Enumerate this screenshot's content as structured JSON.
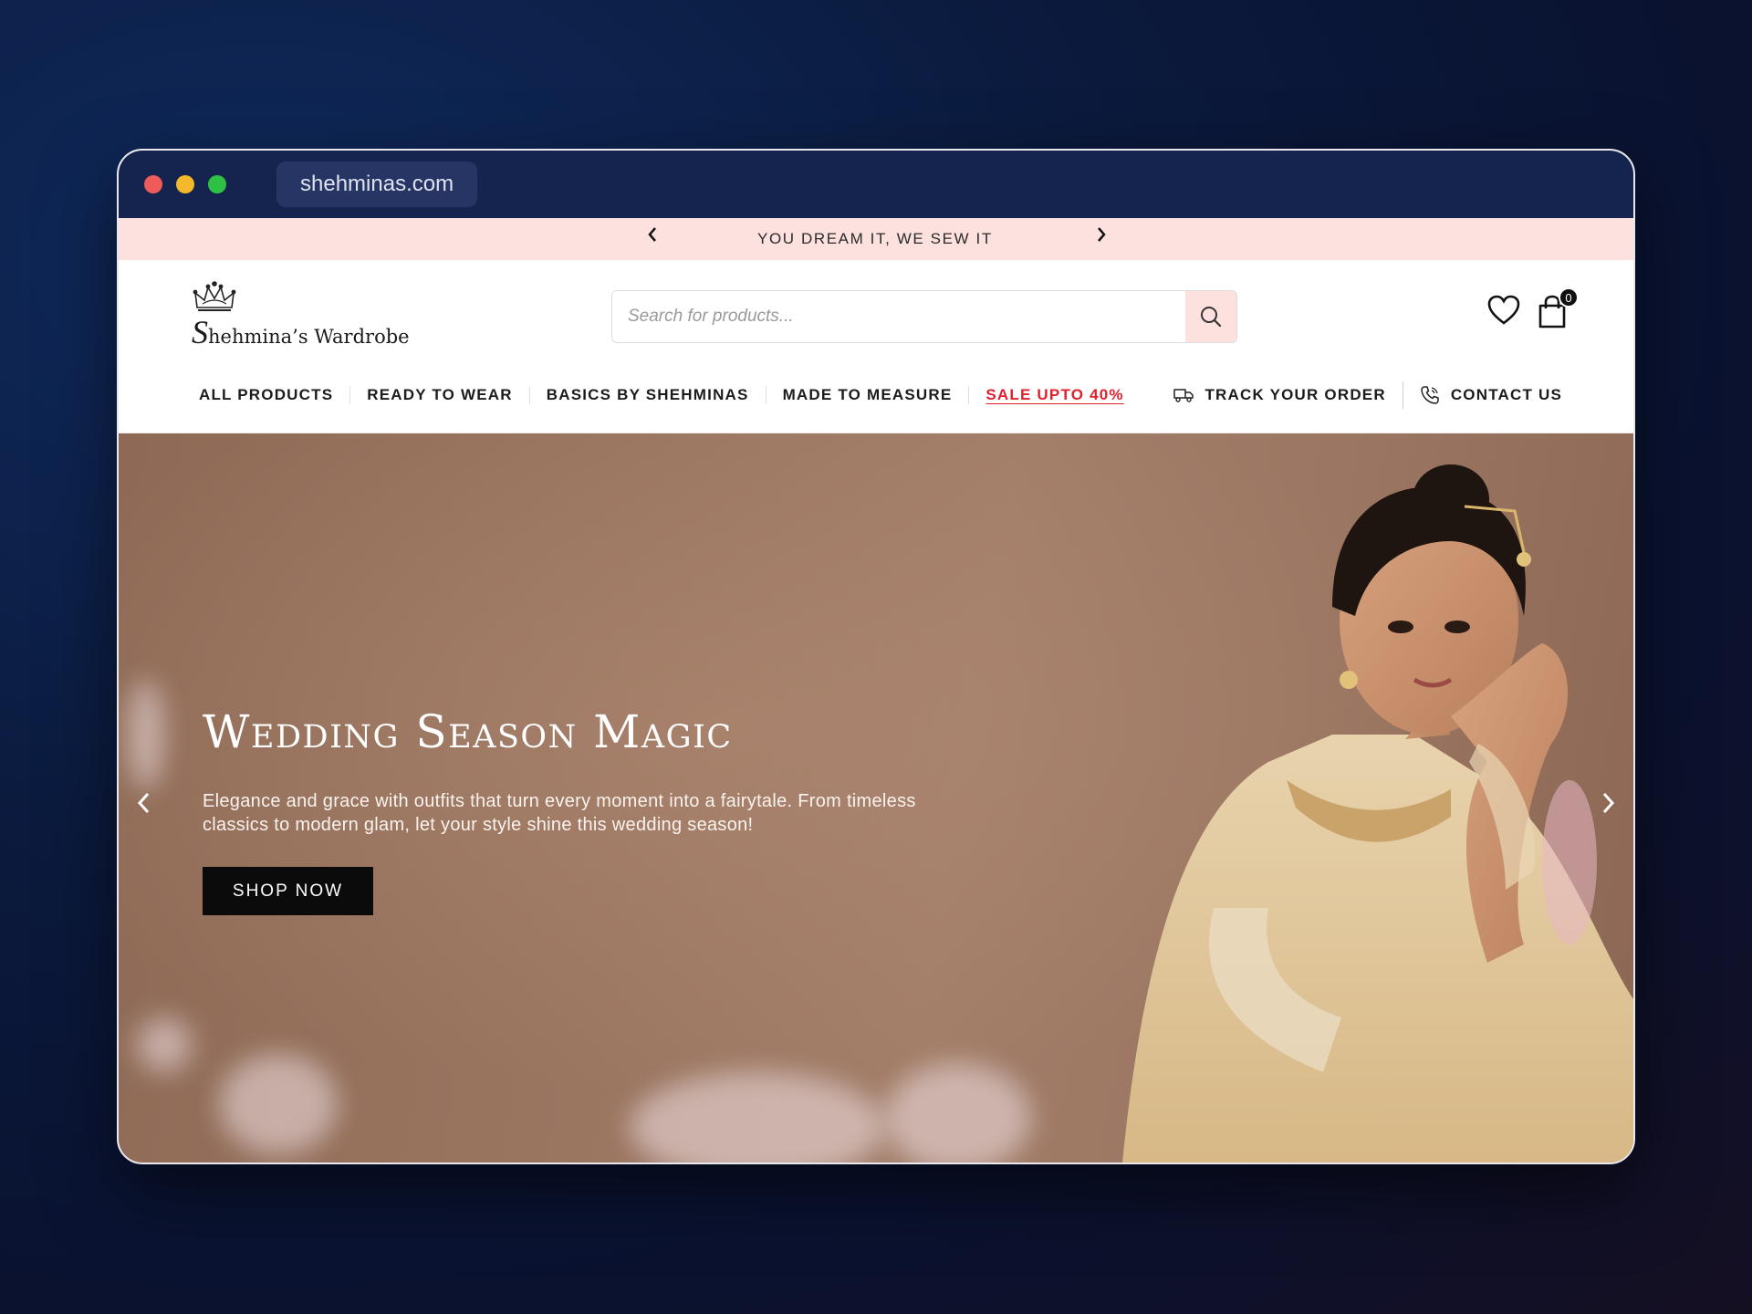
{
  "browser": {
    "url": "shehminas.com"
  },
  "announcement": {
    "text": "YOU DREAM IT, WE SEW IT",
    "prev_icon": "chevron-left-icon",
    "next_icon": "chevron-right-icon"
  },
  "header": {
    "logo_text_initial": "S",
    "logo_text_rest": "hehmina’s Wardrobe",
    "search": {
      "placeholder": "Search for products...",
      "icon": "search-icon"
    },
    "wishlist_icon": "heart-icon",
    "cart": {
      "icon": "shopping-bag-icon",
      "count": "0"
    }
  },
  "nav": {
    "items": [
      {
        "label": "ALL PRODUCTS"
      },
      {
        "label": "READY TO WEAR"
      },
      {
        "label": "BASICS BY SHEHMINAS"
      },
      {
        "label": "MADE TO MEASURE"
      },
      {
        "label": "SALE UPTO 40%",
        "color": "#e0202e"
      }
    ],
    "track_order": {
      "label": "TRACK YOUR ORDER",
      "icon": "delivery-truck-icon"
    },
    "contact": {
      "label": "CONTACT US",
      "icon": "phone-icon"
    }
  },
  "hero": {
    "title": "Wedding Season Magic",
    "text": "Elegance and grace with outfits that turn every moment into a fairytale. From timeless classics to modern glam, let your style shine this wedding season!",
    "button_label": "SHOP NOW",
    "prev_icon": "chevron-left-icon",
    "next_icon": "chevron-right-icon"
  },
  "colors": {
    "announcement_bg": "#fde1df",
    "titlebar_bg": "#15234f",
    "sale_red": "#e0202e",
    "button_black": "#0b0b0b"
  }
}
